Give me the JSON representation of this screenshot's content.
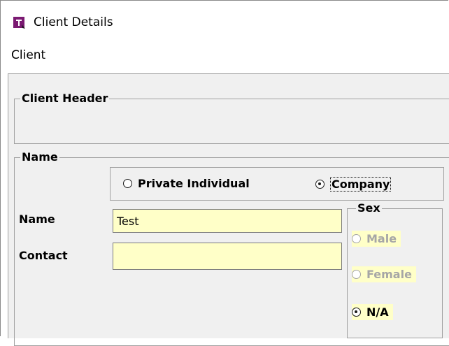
{
  "window": {
    "title": "Client Details",
    "icon": "app-icon",
    "icon_color": "#7b1a72"
  },
  "menu": {
    "items": [
      "Client"
    ]
  },
  "client_header": {
    "legend": "Client Header"
  },
  "name_group": {
    "legend": "Name",
    "type_options": [
      {
        "label": "Private Individual",
        "checked": false
      },
      {
        "label": "Company",
        "checked": true
      }
    ],
    "name_label": "Name",
    "name_value": "Test",
    "contact_label": "Contact",
    "contact_value": ""
  },
  "sex_group": {
    "legend": "Sex",
    "options": [
      {
        "label": "Male",
        "checked": false,
        "enabled": false
      },
      {
        "label": "Female",
        "checked": false,
        "enabled": false
      },
      {
        "label": "N/A",
        "checked": true,
        "enabled": true
      }
    ]
  },
  "colors": {
    "field_background": "#ffffc8",
    "panel_background": "#f0f0f0",
    "disabled_text": "#a6a6a6"
  }
}
